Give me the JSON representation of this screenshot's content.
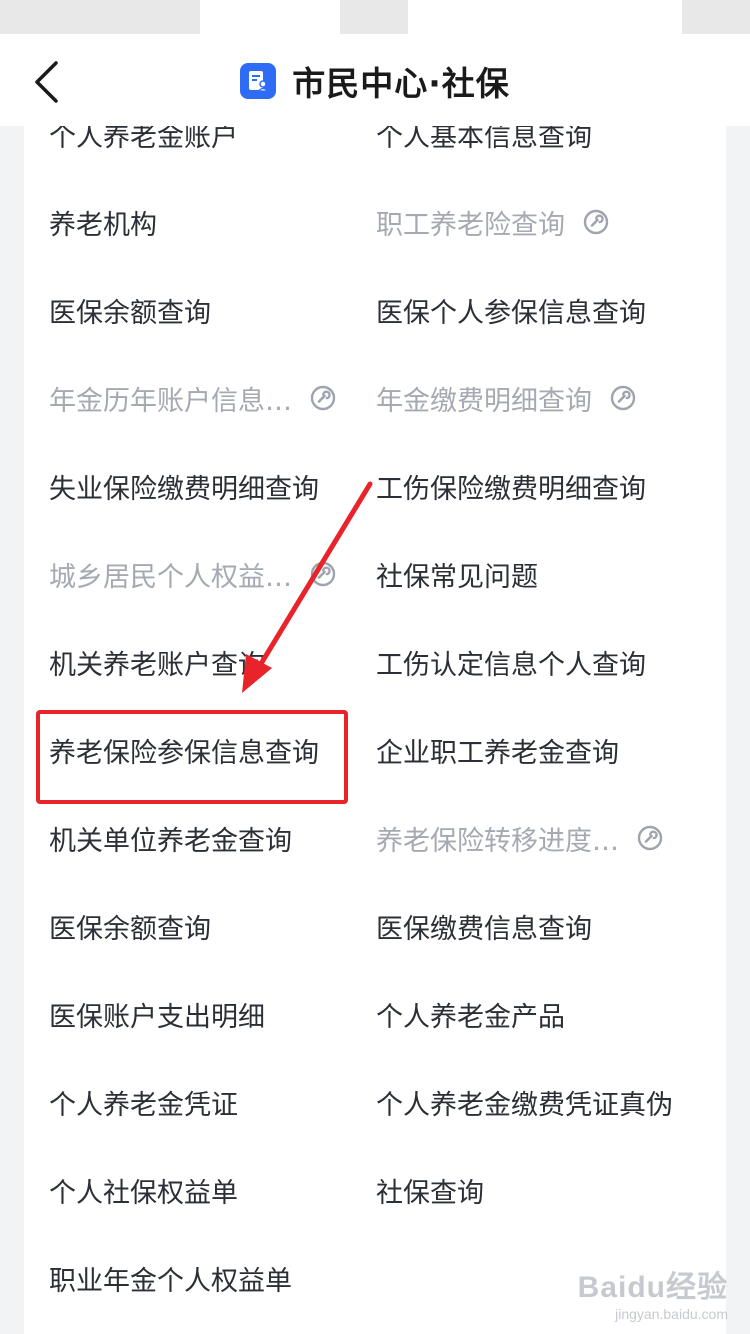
{
  "header": {
    "title": "市民中心·社保",
    "back_icon": "chevron-left-icon",
    "logo_icon": "document-user-icon",
    "logo_color": "#2f6cf6"
  },
  "services": {
    "left": [
      {
        "label": "个人养老金账户",
        "disabled": false
      },
      {
        "label": "养老机构",
        "disabled": false
      },
      {
        "label": "医保余额查询",
        "disabled": false
      },
      {
        "label": "年金历年账户信息…",
        "disabled": true
      },
      {
        "label": "失业保险缴费明细查询",
        "disabled": false
      },
      {
        "label": "城乡居民个人权益…",
        "disabled": true
      },
      {
        "label": "机关养老账户查询",
        "disabled": false
      },
      {
        "label": "养老保险参保信息查询",
        "disabled": false
      },
      {
        "label": "机关单位养老金查询",
        "disabled": false
      },
      {
        "label": "医保余额查询",
        "disabled": false
      },
      {
        "label": "医保账户支出明细",
        "disabled": false
      },
      {
        "label": "个人养老金凭证",
        "disabled": false
      },
      {
        "label": "个人社保权益单",
        "disabled": false
      },
      {
        "label": "职业年金个人权益单",
        "disabled": false
      }
    ],
    "right": [
      {
        "label": "个人基本信息查询",
        "disabled": false
      },
      {
        "label": "职工养老险查询",
        "disabled": true
      },
      {
        "label": "医保个人参保信息查询",
        "disabled": false
      },
      {
        "label": "年金缴费明细查询",
        "disabled": true
      },
      {
        "label": "工伤保险缴费明细查询",
        "disabled": false
      },
      {
        "label": "社保常见问题",
        "disabled": false
      },
      {
        "label": "工伤认定信息个人查询",
        "disabled": false
      },
      {
        "label": "企业职工养老金查询",
        "disabled": false
      },
      {
        "label": "养老保险转移进度…",
        "disabled": true
      },
      {
        "label": "医保缴费信息查询",
        "disabled": false
      },
      {
        "label": "个人养老金产品",
        "disabled": false
      },
      {
        "label": "个人养老金缴费凭证真伪",
        "disabled": false
      },
      {
        "label": "社保查询",
        "disabled": false
      }
    ]
  },
  "annotation": {
    "highlight_color": "#e8232a",
    "highlighted_item": "养老保险参保信息查询"
  },
  "watermark": {
    "logo": "Baidu经验",
    "url": "jingyan.baidu.com"
  },
  "colors": {
    "text": "#2b2f36",
    "disabled_text": "#a5a9b2",
    "background": "#f2f3f5"
  }
}
